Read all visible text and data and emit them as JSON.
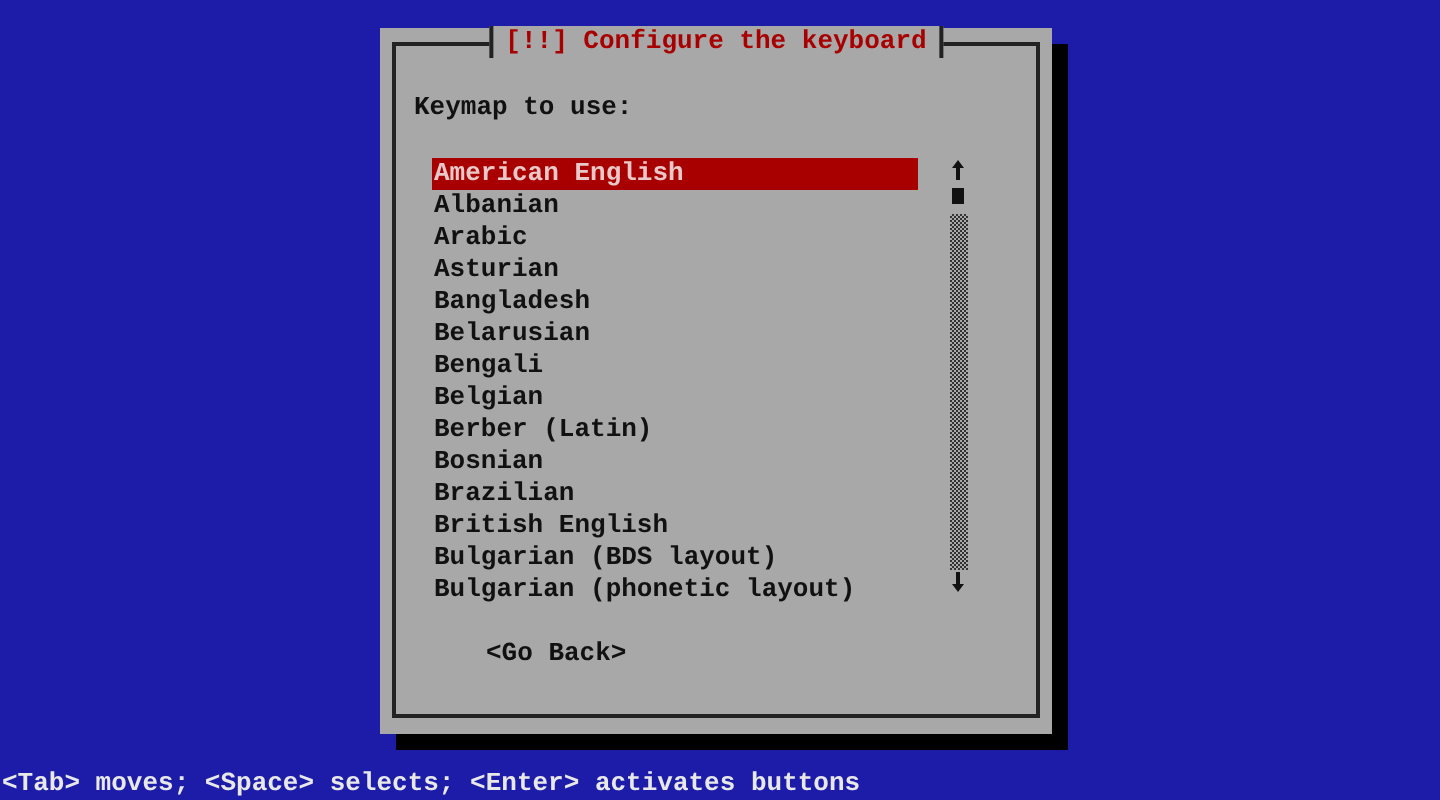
{
  "dialog": {
    "title": "[!!] Configure the keyboard",
    "prompt": "Keymap to use:",
    "keymaps": [
      {
        "label": "American English",
        "selected": true
      },
      {
        "label": "Albanian",
        "selected": false
      },
      {
        "label": "Arabic",
        "selected": false
      },
      {
        "label": "Asturian",
        "selected": false
      },
      {
        "label": "Bangladesh",
        "selected": false
      },
      {
        "label": "Belarusian",
        "selected": false
      },
      {
        "label": "Bengali",
        "selected": false
      },
      {
        "label": "Belgian",
        "selected": false
      },
      {
        "label": "Berber (Latin)",
        "selected": false
      },
      {
        "label": "Bosnian",
        "selected": false
      },
      {
        "label": "Brazilian",
        "selected": false
      },
      {
        "label": "British English",
        "selected": false
      },
      {
        "label": "Bulgarian (BDS layout)",
        "selected": false
      },
      {
        "label": "Bulgarian (phonetic layout)",
        "selected": false
      }
    ],
    "back_button": "<Go Back>"
  },
  "status_bar": "<Tab> moves; <Space> selects; <Enter> activates buttons"
}
